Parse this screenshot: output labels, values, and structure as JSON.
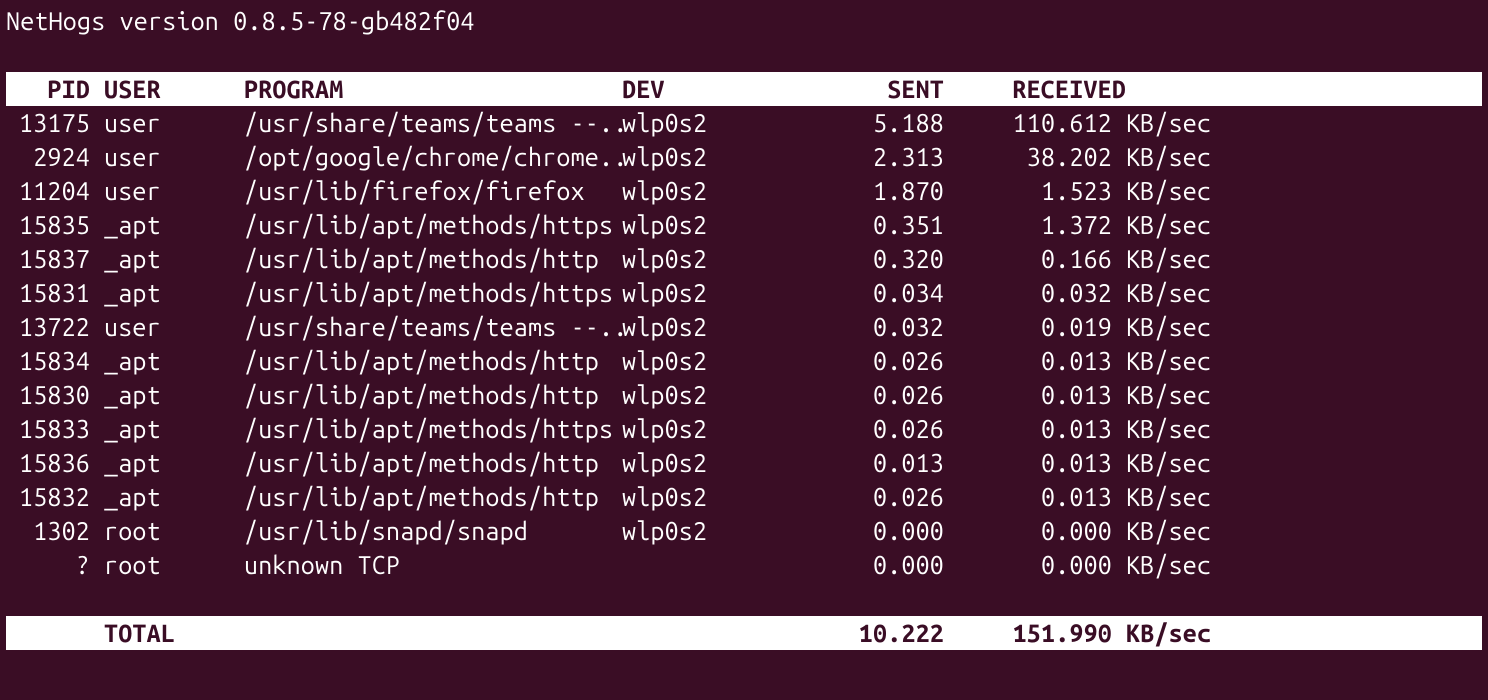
{
  "title": "NetHogs version 0.8.5-78-gb482f04",
  "headers": {
    "pid": "PID",
    "user": "USER",
    "program": "PROGRAM",
    "dev": "DEV",
    "sent": "SENT",
    "received": "RECEIVED"
  },
  "unit_label": "KB/sec",
  "rows": [
    {
      "pid": "13175",
      "user": "user",
      "program": "/usr/share/teams/teams --..",
      "dev": "wlp0s2",
      "sent": "5.188",
      "recv": "110.612"
    },
    {
      "pid": "2924",
      "user": "user",
      "program": "/opt/google/chrome/chrome..",
      "dev": "wlp0s2",
      "sent": "2.313",
      "recv": "38.202"
    },
    {
      "pid": "11204",
      "user": "user",
      "program": "/usr/lib/firefox/firefox",
      "dev": "wlp0s2",
      "sent": "1.870",
      "recv": "1.523"
    },
    {
      "pid": "15835",
      "user": "_apt",
      "program": "/usr/lib/apt/methods/https",
      "dev": "wlp0s2",
      "sent": "0.351",
      "recv": "1.372"
    },
    {
      "pid": "15837",
      "user": "_apt",
      "program": "/usr/lib/apt/methods/http",
      "dev": "wlp0s2",
      "sent": "0.320",
      "recv": "0.166"
    },
    {
      "pid": "15831",
      "user": "_apt",
      "program": "/usr/lib/apt/methods/https",
      "dev": "wlp0s2",
      "sent": "0.034",
      "recv": "0.032"
    },
    {
      "pid": "13722",
      "user": "user",
      "program": "/usr/share/teams/teams --..",
      "dev": "wlp0s2",
      "sent": "0.032",
      "recv": "0.019"
    },
    {
      "pid": "15834",
      "user": "_apt",
      "program": "/usr/lib/apt/methods/http",
      "dev": "wlp0s2",
      "sent": "0.026",
      "recv": "0.013"
    },
    {
      "pid": "15830",
      "user": "_apt",
      "program": "/usr/lib/apt/methods/http",
      "dev": "wlp0s2",
      "sent": "0.026",
      "recv": "0.013"
    },
    {
      "pid": "15833",
      "user": "_apt",
      "program": "/usr/lib/apt/methods/https",
      "dev": "wlp0s2",
      "sent": "0.026",
      "recv": "0.013"
    },
    {
      "pid": "15836",
      "user": "_apt",
      "program": "/usr/lib/apt/methods/http",
      "dev": "wlp0s2",
      "sent": "0.013",
      "recv": "0.013"
    },
    {
      "pid": "15832",
      "user": "_apt",
      "program": "/usr/lib/apt/methods/http",
      "dev": "wlp0s2",
      "sent": "0.026",
      "recv": "0.013"
    },
    {
      "pid": "1302",
      "user": "root",
      "program": "/usr/lib/snapd/snapd",
      "dev": "wlp0s2",
      "sent": "0.000",
      "recv": "0.000"
    },
    {
      "pid": "?",
      "user": "root",
      "program": "unknown TCP",
      "dev": "",
      "sent": "0.000",
      "recv": "0.000"
    }
  ],
  "total": {
    "label": "TOTAL",
    "sent": "10.222",
    "recv": "151.990"
  }
}
